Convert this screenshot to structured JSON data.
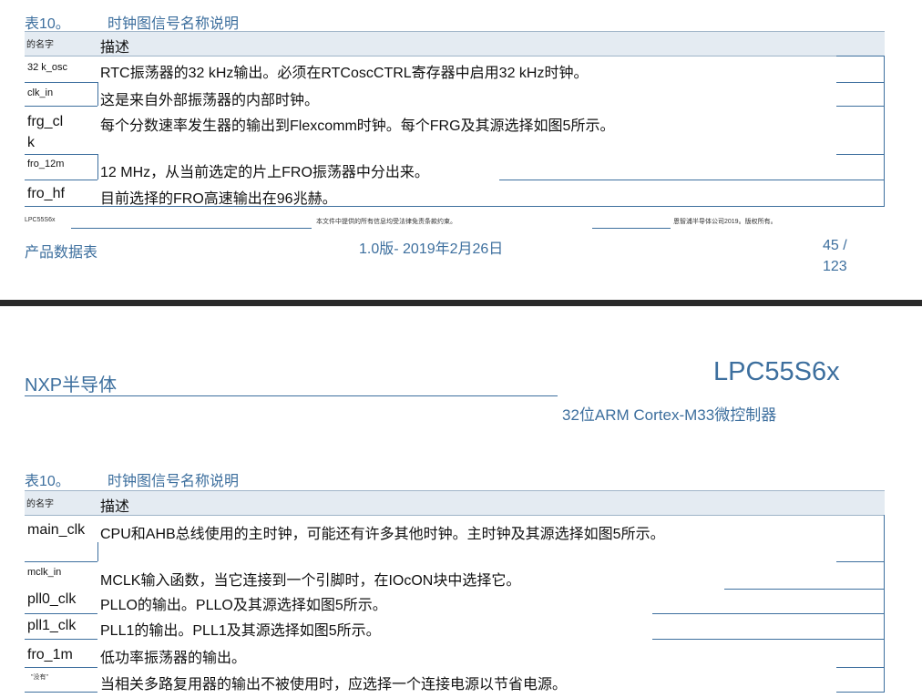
{
  "top_page": {
    "caption_num": "表10。",
    "caption_title": "时钟图信号名称说明",
    "header_name": "的名字",
    "header_desc": "描述",
    "rows": [
      {
        "name": "32 k_osc",
        "desc": "RTC振荡器的32 kHz输出。必须在RTCoscCTRL寄存器中启用32 kHz时钟。"
      },
      {
        "name": "clk_in",
        "desc": "这是来自外部振荡器的内部时钟。"
      },
      {
        "name_line1": "frg_cl",
        "name_line2": "k",
        "desc": "每个分数速率发生器的输出到Flexcomm时钟。每个FRG及其源选择如图5所示。"
      },
      {
        "name": "fro_12m",
        "desc": "12 MHz，从当前选定的片上FRO振荡器中分出来。"
      },
      {
        "name": "fro_hf",
        "desc": "目前选择的FRO高速输出在96兆赫。"
      }
    ],
    "footer_left_small": "LPC55S6x",
    "footer_mid_small": "本文件中提供的所有信息均受法律免责条款约束。",
    "footer_right_small": "恩智浦半导体公司2019。版权所有。",
    "footer_left": "产品数据表",
    "footer_center": "1.0版- 2019年2月26日",
    "page_num": "45 /",
    "page_total": "123"
  },
  "bottom_page": {
    "company": "NXP半导体",
    "product": "LPC55S6x",
    "subtitle": "32位ARM Cortex-M33微控制器",
    "caption_num": "表10。",
    "caption_title": "时钟图信号名称说明",
    "header_name": "的名字",
    "header_desc": "描述",
    "rows": [
      {
        "name": "main_clk",
        "desc": "CPU和AHB总线使用的主时钟，可能还有许多其他时钟。主时钟及其源选择如图5所示。"
      },
      {
        "name": "mclk_in",
        "desc": "MCLK输入函数，当它连接到一个引脚时，在IOcON块中选择它。"
      },
      {
        "name": "pll0_clk",
        "desc": "PLLO的输出。PLLO及其源选择如图5所示。"
      },
      {
        "name": "pll1_clk",
        "desc": "PLL1的输出。PLL1及其源选择如图5所示。"
      },
      {
        "name": "fro_1m",
        "desc": "低功率振荡器的输出。"
      },
      {
        "name": "\"没有\"",
        "desc": "当相关多路复用器的输出不被使用时，应选择一个连接电源以节省电源。"
      }
    ]
  }
}
